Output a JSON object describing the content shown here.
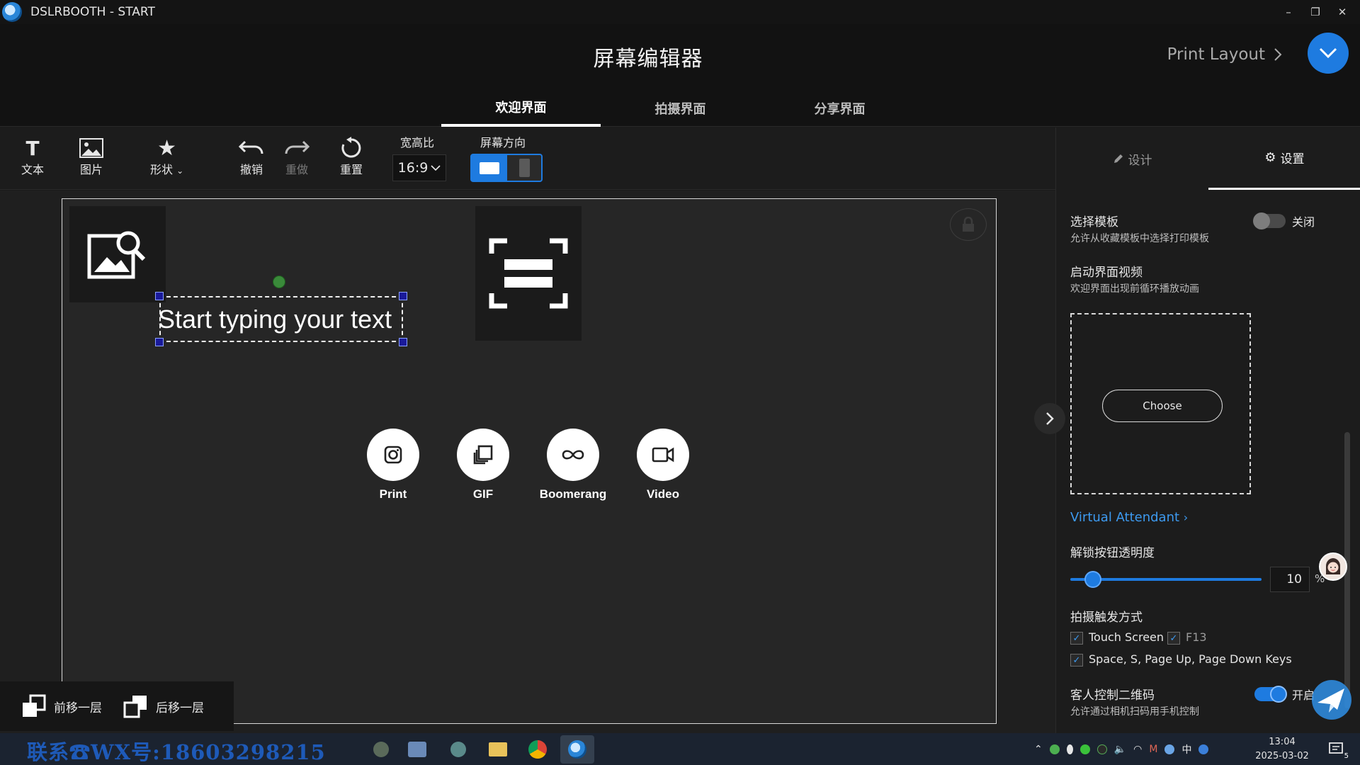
{
  "window": {
    "title": "DSLRBOOTH - START",
    "controls": [
      "–",
      "❐",
      "✕"
    ]
  },
  "header": {
    "title": "屏幕编辑器",
    "print_layout": "Print Layout",
    "tabs": [
      {
        "label": "欢迎界面",
        "active": true
      },
      {
        "label": "拍摄界面",
        "active": false
      },
      {
        "label": "分享界面",
        "active": false
      }
    ]
  },
  "toolbar": {
    "text_label": "文本",
    "image_label": "图片",
    "shape_label": "形状",
    "undo_label": "撤销",
    "redo_label": "重做",
    "reset_label": "重置",
    "aspect_label": "宽高比",
    "aspect_value": "16:9",
    "orientation_label": "屏幕方向"
  },
  "canvas": {
    "text_placeholder": "Start typing your text",
    "modes": [
      {
        "label": "Print",
        "icon": "camera-icon"
      },
      {
        "label": "GIF",
        "icon": "gif-icon"
      },
      {
        "label": "Boomerang",
        "icon": "infinity-icon"
      },
      {
        "label": "Video",
        "icon": "video-icon"
      }
    ],
    "bring_forward": "前移一层",
    "send_backward": "后移一层"
  },
  "panel": {
    "tab_design": "设计",
    "tab_settings": "设置",
    "template": {
      "title": "选择模板",
      "desc": "允许从收藏模板中选择打印模板",
      "state": "关闭"
    },
    "intro_video": {
      "title": "启动界面视频",
      "desc": "欢迎界面出现前循环播放动画",
      "choose": "Choose"
    },
    "virtual_attendant": "Virtual Attendant",
    "unlock_opacity": {
      "title": "解锁按钮透明度",
      "value": "10",
      "unit": "%",
      "fraction": 0.1
    },
    "trigger": {
      "title": "拍摄触发方式",
      "touch_screen": "Touch Screen",
      "f13": "F13",
      "keys": "Space, S, Page Up, Page Down Keys"
    },
    "guest_qr": {
      "title": "客人控制二维码",
      "desc": "允许通过相机扫码用手机控制",
      "state": "开启"
    }
  },
  "taskbar": {
    "contact": "联系☎WX号:18603298215",
    "time": "13:04",
    "date": "2025-03-02",
    "ime": "中",
    "notif_count": "5"
  },
  "colors": {
    "accent": "#1e7be0",
    "link": "#3d9af0"
  }
}
